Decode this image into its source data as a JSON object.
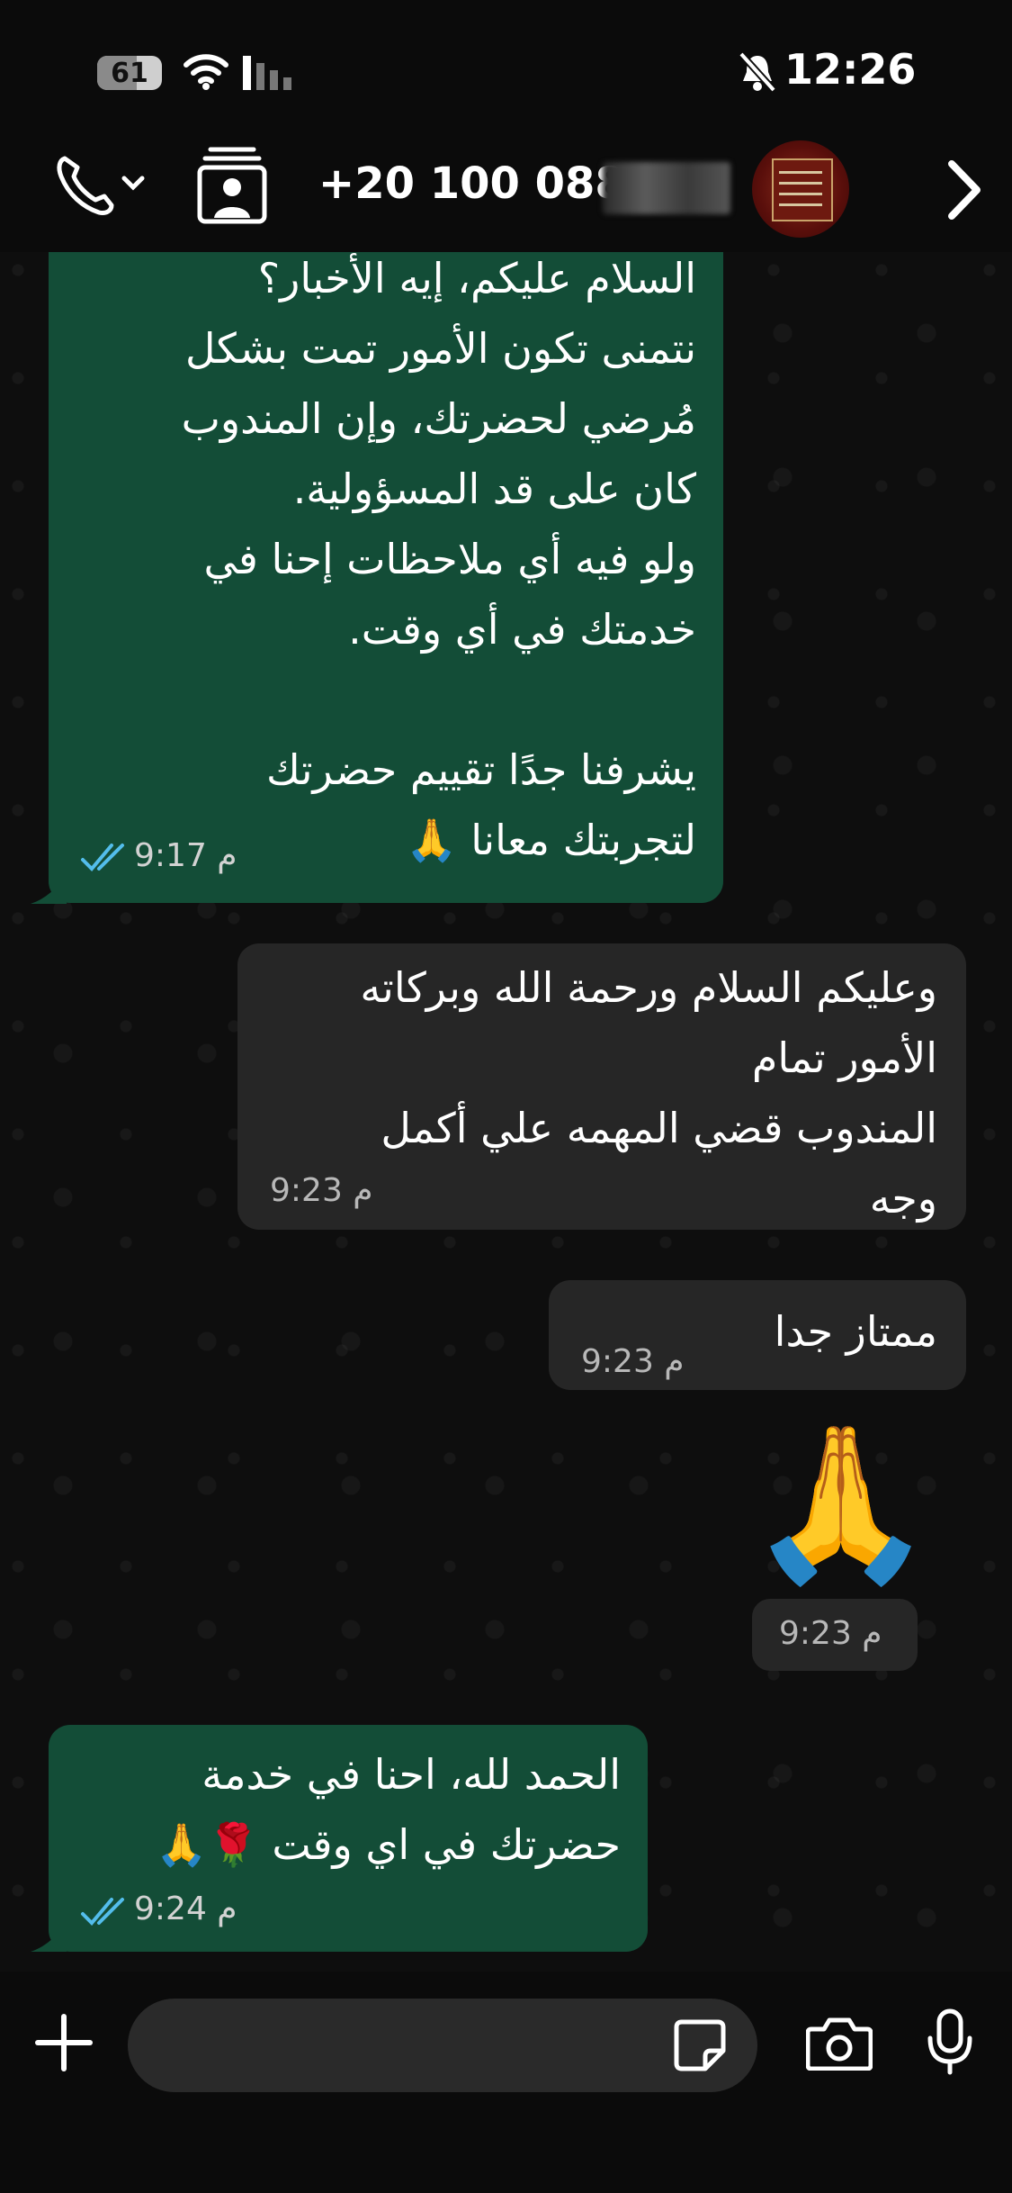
{
  "status_bar": {
    "battery": "61",
    "battery_level": 0.61,
    "time": "12:26",
    "icons": [
      "wifi-icon",
      "signal-icon",
      "silent-bell-icon"
    ]
  },
  "header": {
    "contact_name": "+20 100 088",
    "icons": [
      "phone-icon",
      "contact-card-icon",
      "avatar",
      "chevron-right-icon"
    ]
  },
  "messages": [
    {
      "direction": "outgoing",
      "text": "السلام عليكم، إيه الأخبار؟\nنتمنى تكون الأمور تمت بشكل\nمُرضي لحضرتك، وإن المندوب\nكان على قد المسؤولية.\nولو فيه أي ملاحظات إحنا في\nخدمتك في أي وقت.\n\nيشرفنا جدًا تقييم حضرتك\nلتجربتك معانا 🙏",
      "time": "9:17 م",
      "status": "read"
    },
    {
      "direction": "incoming",
      "text": "وعليكم السلام ورحمة الله وبركاته\nالأمور تمام\nالمندوب  قضي المهمه علي أكمل\nوجه",
      "time": "9:23 م"
    },
    {
      "direction": "incoming",
      "text": "ممتاز جدا",
      "time": "9:23 م"
    },
    {
      "direction": "incoming",
      "emoji": "🙏",
      "time": "9:23 م"
    },
    {
      "direction": "outgoing",
      "text": "الحمد لله، احنا في خدمة\nحضرتك في اي وقت 🌹🙏",
      "time": "9:24 م",
      "status": "read"
    }
  ],
  "input": {
    "placeholder": "",
    "icons": [
      "plus-icon",
      "sticker-icon",
      "camera-icon",
      "microphone-icon"
    ]
  },
  "colors": {
    "outgoing_bubble": "#134d37",
    "incoming_bubble": "#262626",
    "read_ticks": "#53bdeb",
    "background": "#0b0b0b"
  }
}
